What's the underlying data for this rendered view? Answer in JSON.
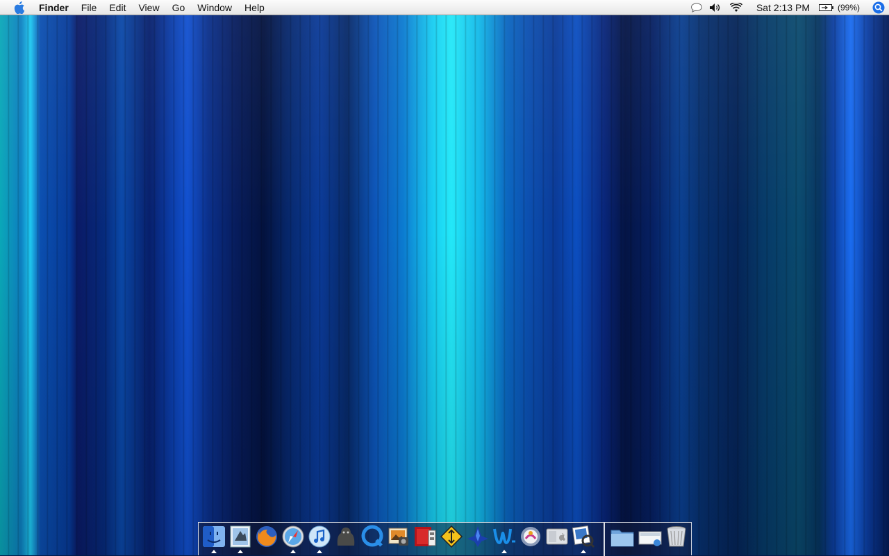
{
  "menubar": {
    "apple_icon": "apple-logo-icon",
    "app_name": "Finder",
    "menus": [
      "File",
      "Edit",
      "View",
      "Go",
      "Window",
      "Help"
    ],
    "status": {
      "chat_icon": "speech-bubble-icon",
      "volume_icon": "speaker-icon",
      "wifi_icon": "wifi-icon",
      "clock": "Sat 2:13 PM",
      "battery_icon": "battery-icon",
      "battery_percent": "(99%)",
      "spotlight_icon": "spotlight-search-icon"
    }
  },
  "dock": {
    "apps": [
      {
        "name": "finder-icon",
        "running": true
      },
      {
        "name": "mail-icon",
        "running": true
      },
      {
        "name": "firefox-icon",
        "running": false
      },
      {
        "name": "safari-icon",
        "running": true
      },
      {
        "name": "itunes-icon",
        "running": true
      },
      {
        "name": "adium-icon",
        "running": false
      },
      {
        "name": "quicktime-icon",
        "running": false
      },
      {
        "name": "iphoto-icon",
        "running": false
      },
      {
        "name": "front-row-icon",
        "running": false
      },
      {
        "name": "transmit-icon",
        "running": false
      },
      {
        "name": "dashcode-icon",
        "running": false
      },
      {
        "name": "textwrangler-icon",
        "running": true
      },
      {
        "name": "camino-icon",
        "running": false
      },
      {
        "name": "boot-camp-icon",
        "running": false
      },
      {
        "name": "preview-icon",
        "running": true
      }
    ],
    "stacks": [
      {
        "name": "applications-folder-icon"
      },
      {
        "name": "downloads-stack-icon"
      },
      {
        "name": "trash-icon"
      }
    ]
  }
}
